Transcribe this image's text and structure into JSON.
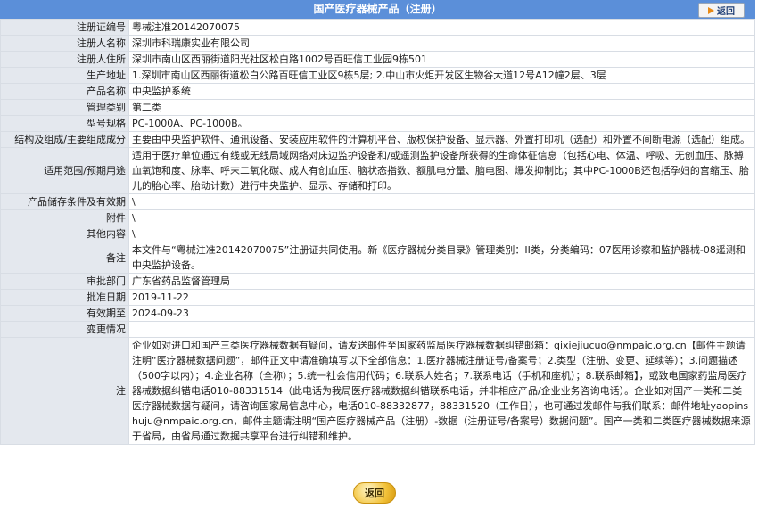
{
  "header": {
    "title": "国产医疗器械产品（注册）",
    "back_label": "返回"
  },
  "rows": [
    {
      "label": "注册证编号",
      "value": "粤械注准20142070075"
    },
    {
      "label": "注册人名称",
      "value": "深圳市科瑞康实业有限公司"
    },
    {
      "label": "注册人住所",
      "value": "深圳市南山区西丽街道阳光社区松白路1002号百旺信工业园9栋501"
    },
    {
      "label": "生产地址",
      "value": "1.深圳市南山区西丽街道松白公路百旺信工业区9栋5层; 2.中山市火炬开发区生物谷大道12号A12幢2层、3层"
    },
    {
      "label": "产品名称",
      "value": "中央监护系统"
    },
    {
      "label": "管理类别",
      "value": "第二类"
    },
    {
      "label": "型号规格",
      "value": "PC-1000A、PC-1000B。"
    },
    {
      "label": "结构及组成/主要组成成分",
      "value": "主要由中央监护软件、通讯设备、安装应用软件的计算机平台、版权保护设备、显示器、外置打印机（选配）和外置不间断电源（选配）组成。"
    },
    {
      "label": "适用范围/预期用途",
      "value": "适用于医疗单位通过有线或无线局域网络对床边监护设备和/或遥测监护设备所获得的生命体征信息（包括心电、体温、呼吸、无创血压、脉搏血氧饱和度、脉率、呼末二氧化碳、成人有创血压、脑状态指数、额肌电分量、脑电图、爆发抑制比；其中PC-1000B还包括孕妇的宫缩压、胎儿的胎心率、胎动计数）进行中央监护、显示、存储和打印。"
    },
    {
      "label": "产品储存条件及有效期",
      "value": "\\"
    },
    {
      "label": "附件",
      "value": "\\"
    },
    {
      "label": "其他内容",
      "value": "\\"
    },
    {
      "label": "备注",
      "value": "本文件与“粤械注准20142070075”注册证共同使用。新《医疗器械分类目录》管理类别：II类，分类编码：07医用诊察和监护器械-08遥测和中央监护设备。"
    },
    {
      "label": "审批部门",
      "value": "广东省药品监督管理局"
    },
    {
      "label": "批准日期",
      "value": "2019-11-22"
    },
    {
      "label": "有效期至",
      "value": "2024-09-23"
    },
    {
      "label": "变更情况",
      "value": ""
    },
    {
      "label": "注",
      "value": "企业如对进口和国产三类医疗器械数据有疑问，请发送邮件至国家药监局医疗器械数据纠错邮箱：qixiejiucuo@nmpaic.org.cn【邮件主题请注明“医疗器械数据问题”，邮件正文中请准确填写以下全部信息：1.医疗器械注册证号/备案号；2.类型（注册、变更、延续等）；3.问题描述（500字以内）；4.企业名称（全称）；5.统一社会信用代码；6.联系人姓名；7.联系电话（手机和座机）；8.联系邮箱】，或致电国家药监局医疗器械数据纠错电话010-88331514（此电话为我局医疗器械数据纠错联系电话，并非相应产品/企业业务咨询电话）。企业如对国产一类和二类医疗器械数据有疑问，请咨询国家局信息中心，电话010-88332877，88331520（工作日），也可通过发邮件与我们联系：邮件地址yaopinshuju@nmpaic.org.cn，邮件主题请注明“国产医疗器械产品（注册）-数据（注册证号/备案号）数据问题”。国产一类和二类医疗器械数据来源于省局，由省局通过数据共享平台进行纠错和维护。"
    }
  ],
  "footer": {
    "back_label": "返回"
  },
  "colors": {
    "title_bar": "#5b8fd9",
    "label_bg": "#e4e8ee",
    "accent_arrow": "#e88a16",
    "back_button": "#f2c23a"
  }
}
